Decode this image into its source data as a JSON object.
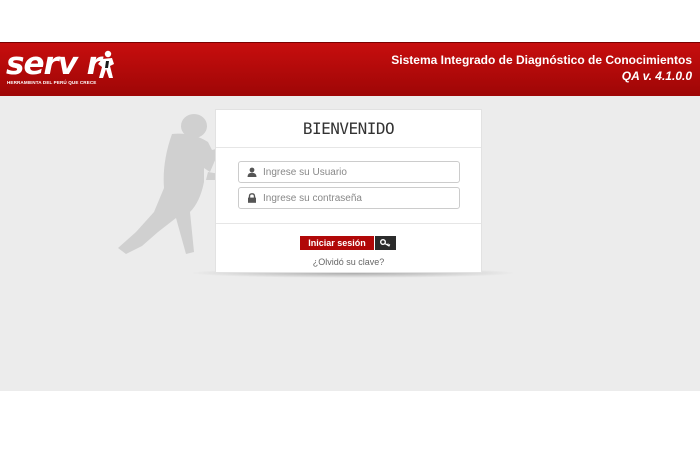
{
  "header": {
    "logo_text": "servir",
    "logo_tagline": "HERRAMIENTA DEL PERÚ QUE CRECE",
    "system_title": "Sistema Integrado de Diagnóstico de Conocimientos",
    "version": "QA v. 4.1.0.0"
  },
  "login": {
    "title": "BIENVENIDO",
    "username": {
      "placeholder": "Ingrese su Usuario",
      "value": "",
      "icon": "user-icon"
    },
    "password": {
      "placeholder": "Ingrese su contraseña",
      "value": "",
      "icon": "lock-icon"
    },
    "submit_label": "Iniciar sesión",
    "key_icon": "key-icon",
    "forgot_label": "¿Olvidó su clave?"
  },
  "colors": {
    "header_red": "#b30b0b",
    "button_red": "#b10808",
    "key_button": "#2b2b2b",
    "background": "#ececec"
  }
}
